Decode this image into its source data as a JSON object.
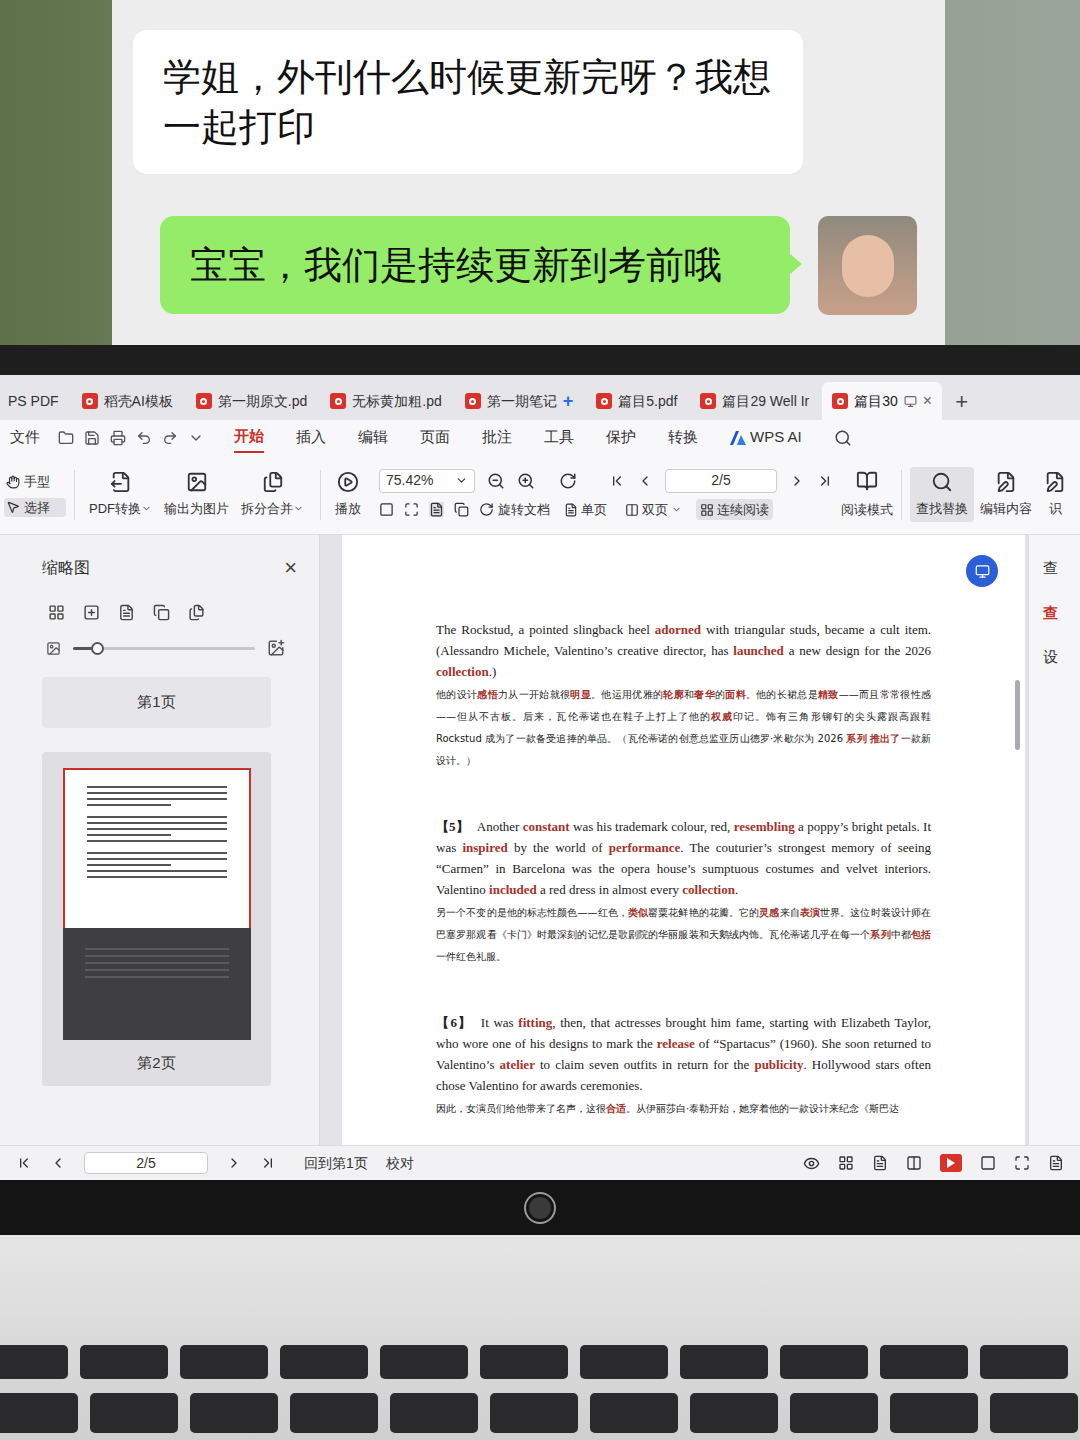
{
  "chat": {
    "messages": [
      {
        "side": "received",
        "text": "学姐，外刊什么时候更新完呀？我想一起打印"
      },
      {
        "side": "sent",
        "text": "宝宝，我们是持续更新到考前哦"
      }
    ]
  },
  "app": {
    "tabs": [
      {
        "label": "PS PDF",
        "selected": false,
        "badge": ""
      },
      {
        "label": "稻壳AI模板",
        "selected": false,
        "badge": ""
      },
      {
        "label": "第一期原文.pd",
        "selected": false,
        "badge": ""
      },
      {
        "label": "无标黄加粗.pd",
        "selected": false,
        "badge": ""
      },
      {
        "label": "第一期笔记",
        "selected": false,
        "badge": "+"
      },
      {
        "label": "篇目5.pdf",
        "selected": false,
        "badge": ""
      },
      {
        "label": "篇目29 Well Ir",
        "selected": false,
        "badge": ""
      },
      {
        "label": "篇目30",
        "selected": true,
        "badge": ""
      }
    ],
    "tab_close": "×",
    "tab_add": "+",
    "file_menu": "文件",
    "menu": [
      {
        "label": "开始",
        "selected": true,
        "kind": "text"
      },
      {
        "label": "插入",
        "selected": false,
        "kind": "text"
      },
      {
        "label": "编辑",
        "selected": false,
        "kind": "text"
      },
      {
        "label": "页面",
        "selected": false,
        "kind": "text"
      },
      {
        "label": "批注",
        "selected": false,
        "kind": "text"
      },
      {
        "label": "工具",
        "selected": false,
        "kind": "text"
      },
      {
        "label": "保护",
        "selected": false,
        "kind": "text"
      },
      {
        "label": "转换",
        "selected": false,
        "kind": "text"
      },
      {
        "label": "WPS AI",
        "selected": false,
        "kind": "ai"
      }
    ],
    "toolbar": {
      "hand_tools": [
        {
          "label": "手型",
          "selected": false
        },
        {
          "label": "选择",
          "selected": true
        }
      ],
      "buttons": [
        {
          "label": "PDF转换",
          "dropdown": true
        },
        {
          "label": "输出为图片",
          "dropdown": false
        },
        {
          "label": "拆分合并",
          "dropdown": true
        }
      ],
      "play": "播放",
      "zoom": "75.42%",
      "page": "2/5",
      "rotate": "旋转文档",
      "views": [
        {
          "label": "单页",
          "selected": false,
          "dropdown": false
        },
        {
          "label": "双页",
          "selected": false,
          "dropdown": true
        },
        {
          "label": "连续阅读",
          "selected": true,
          "dropdown": false
        }
      ],
      "reading_mode": "阅读模式",
      "right": [
        {
          "label": "查找替换",
          "selected": true
        },
        {
          "label": "编辑内容",
          "selected": false
        },
        {
          "label": "识",
          "selected": false
        }
      ]
    },
    "sidebar": {
      "title": "缩略图",
      "close": "×",
      "level": 0.13,
      "pages": [
        {
          "label": "第1页",
          "selected": false
        },
        {
          "label": "第2页",
          "selected": true
        }
      ]
    },
    "document": {
      "paragraphs": [
        {
          "label": "",
          "english": [
            {
              "text": "The Rockstud, a pointed slingback heel ",
              "highlight": false
            },
            {
              "text": "adorned",
              "highlight": true
            },
            {
              "text": " with triangular studs, became a cult item. (Alessandro Michele, Valentino’s creative director, has ",
              "highlight": false
            },
            {
              "text": "launched",
              "highlight": true
            },
            {
              "text": " a new design for the 2026 ",
              "highlight": false
            },
            {
              "text": "collection",
              "highlight": true
            },
            {
              "text": ".)",
              "highlight": false
            }
          ],
          "chinese": [
            {
              "text": "他的设计",
              "highlight": false
            },
            {
              "text": "感悟",
              "highlight": true
            },
            {
              "text": "力从一开始就很",
              "highlight": false
            },
            {
              "text": "明显",
              "highlight": true
            },
            {
              "text": "。他运用优雅的",
              "highlight": false
            },
            {
              "text": "轮廓",
              "highlight": true
            },
            {
              "text": "和",
              "highlight": false
            },
            {
              "text": "奢华",
              "highlight": true
            },
            {
              "text": "的",
              "highlight": false
            },
            {
              "text": "面料",
              "highlight": true
            },
            {
              "text": "。他的长裙总是",
              "highlight": false
            },
            {
              "text": "精致",
              "highlight": true
            },
            {
              "text": "——而且常常很性感——但从不古板。后来，瓦伦蒂诺也在鞋子上打上了他的",
              "highlight": false
            },
            {
              "text": "权威",
              "highlight": true
            },
            {
              "text": "印记。饰有三角形铆钉的尖头露跟高跟鞋 Rockstud 成为了一款备受追捧的单品。（瓦伦蒂诺的创意总监亚历山德罗·米歇尔为 2026 ",
              "highlight": false
            },
            {
              "text": "系列",
              "highlight": true
            },
            {
              "text": " ",
              "highlight": false
            },
            {
              "text": "推出了",
              "highlight": true
            },
            {
              "text": "一款新设计。）",
              "highlight": false
            }
          ]
        },
        {
          "label": "【5】",
          "english": [
            {
              "text": "Another ",
              "highlight": false
            },
            {
              "text": "constant",
              "highlight": true
            },
            {
              "text": " was his trademark colour, red, ",
              "highlight": false
            },
            {
              "text": "resembling",
              "highlight": true
            },
            {
              "text": " a poppy’s bright petals. It was ",
              "highlight": false
            },
            {
              "text": "inspired",
              "highlight": true
            },
            {
              "text": " by the world of ",
              "highlight": false
            },
            {
              "text": "performance",
              "highlight": true
            },
            {
              "text": ". The couturier’s strongest memory of seeing “Carmen” in Barcelona was the opera house’s sumptuous costumes and velvet interiors. Valentino ",
              "highlight": false
            },
            {
              "text": "included",
              "highlight": true
            },
            {
              "text": " a red dress in almost every ",
              "highlight": false
            },
            {
              "text": "collection",
              "highlight": true
            },
            {
              "text": ".",
              "highlight": false
            }
          ],
          "chinese": [
            {
              "text": "另一个不变的是他的标志性颜色——红色，",
              "highlight": false
            },
            {
              "text": "类似",
              "highlight": true
            },
            {
              "text": "罂粟花鲜艳的花瓣。它的",
              "highlight": false
            },
            {
              "text": "灵感",
              "highlight": true
            },
            {
              "text": "来自",
              "highlight": false
            },
            {
              "text": "表演",
              "highlight": true
            },
            {
              "text": "世界。这位时装设计师在巴塞罗那观看《卡门》时最深刻的记忆是歌剧院的华丽服装和天鹅绒内饰。瓦伦蒂诺几乎在每一个",
              "highlight": false
            },
            {
              "text": "系列",
              "highlight": true
            },
            {
              "text": "中都",
              "highlight": false
            },
            {
              "text": "包括",
              "highlight": true
            },
            {
              "text": "一件红色礼服。",
              "highlight": false
            }
          ]
        },
        {
          "label": "【6】",
          "english": [
            {
              "text": "It was ",
              "highlight": false
            },
            {
              "text": "fitting",
              "highlight": true
            },
            {
              "text": ", then, that actresses brought him fame, starting with Elizabeth Taylor, who wore one of his designs to mark the ",
              "highlight": false
            },
            {
              "text": "release",
              "highlight": true
            },
            {
              "text": " of “Spartacus” (1960). She soon returned to Valentino’s ",
              "highlight": false
            },
            {
              "text": "atelier",
              "highlight": true
            },
            {
              "text": " to claim seven outfits in return for the ",
              "highlight": false
            },
            {
              "text": "publicity",
              "highlight": true
            },
            {
              "text": ". Hollywood stars often chose Valentino for awards ceremonies.",
              "highlight": false
            }
          ],
          "chinese": [
            {
              "text": "因此，女演员们给他带来了名声，这很",
              "highlight": false
            },
            {
              "text": "合适",
              "highlight": true
            },
            {
              "text": "。从伊丽莎白·泰勒开始，她穿着他的一款设计来纪念《斯巴达",
              "highlight": false
            }
          ]
        }
      ]
    },
    "right_panel": [
      "查",
      "查",
      "设"
    ],
    "status_bar": {
      "page": "2/5",
      "first_page": "回到第1页",
      "proofread": "校对"
    }
  }
}
